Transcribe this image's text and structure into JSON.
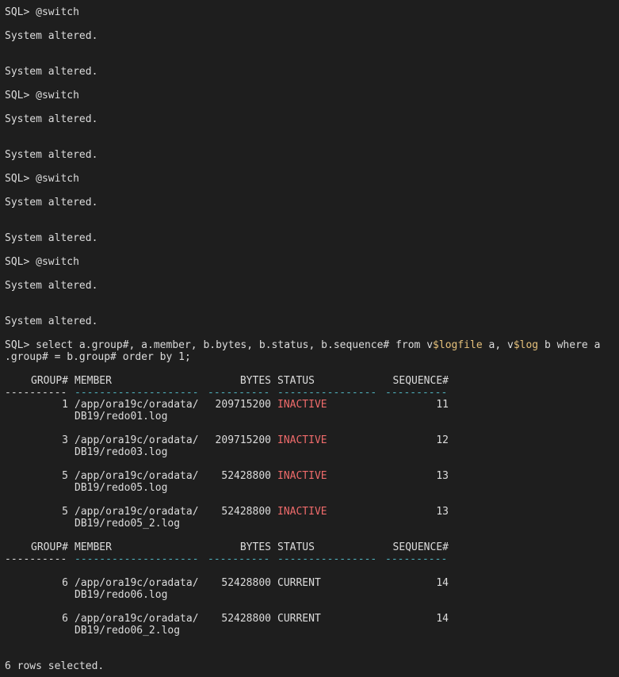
{
  "theme": {
    "background": "#1e1e1e",
    "foreground": "#dcdcdc",
    "highlight_yellow": "#e5c07b",
    "status_inactive": "#ef6b6b",
    "underline_cyan": "#4fb3bf"
  },
  "session": {
    "switch_runs": [
      {
        "command": "SQL> @switch",
        "result_1": "System altered.",
        "result_2": "System altered."
      },
      {
        "command": "SQL> @switch",
        "result_1": "System altered.",
        "result_2": "System altered."
      },
      {
        "command": "SQL> @switch",
        "result_1": "System altered.",
        "result_2": "System altered."
      },
      {
        "command": "SQL> @switch",
        "result_1": "System altered.",
        "result_2": "System altered."
      }
    ],
    "query": {
      "part_1": "SQL> select a.group#, a.member, b.bytes, b.status, b.sequence# from v",
      "highlight_1": "$logfile",
      "part_2": " a, v",
      "highlight_2": "$log",
      "part_3": " b where a",
      "line_2": ".group# = b.group# order by 1;"
    },
    "headers": {
      "group": "GROUP#",
      "member": "MEMBER",
      "bytes": "BYTES",
      "status": "STATUS",
      "sequence": "SEQUENCE#"
    },
    "underline": {
      "group": "----------",
      "member": "--------------------",
      "bytes": "----------",
      "status": "----------------",
      "sequence": "----------"
    },
    "page_1_rows": [
      {
        "group": "1",
        "member_1": "/app/ora19c/oradata/",
        "member_2": "DB19/redo01.log",
        "bytes": "209715200",
        "status": "INACTIVE",
        "sequence": "11"
      },
      {
        "group": "3",
        "member_1": "/app/ora19c/oradata/",
        "member_2": "DB19/redo03.log",
        "bytes": "209715200",
        "status": "INACTIVE",
        "sequence": "12"
      },
      {
        "group": "5",
        "member_1": "/app/ora19c/oradata/",
        "member_2": "DB19/redo05.log",
        "bytes": "52428800",
        "status": "INACTIVE",
        "sequence": "13"
      },
      {
        "group": "5",
        "member_1": "/app/ora19c/oradata/",
        "member_2": "DB19/redo05_2.log",
        "bytes": "52428800",
        "status": "INACTIVE",
        "sequence": "13"
      }
    ],
    "page_2_rows": [
      {
        "group": "6",
        "member_1": "/app/ora19c/oradata/",
        "member_2": "DB19/redo06.log",
        "bytes": "52428800",
        "status": "CURRENT",
        "sequence": "14"
      },
      {
        "group": "6",
        "member_1": "/app/ora19c/oradata/",
        "member_2": "DB19/redo06_2.log",
        "bytes": "52428800",
        "status": "CURRENT",
        "sequence": "14"
      }
    ],
    "footer": "6 rows selected."
  }
}
